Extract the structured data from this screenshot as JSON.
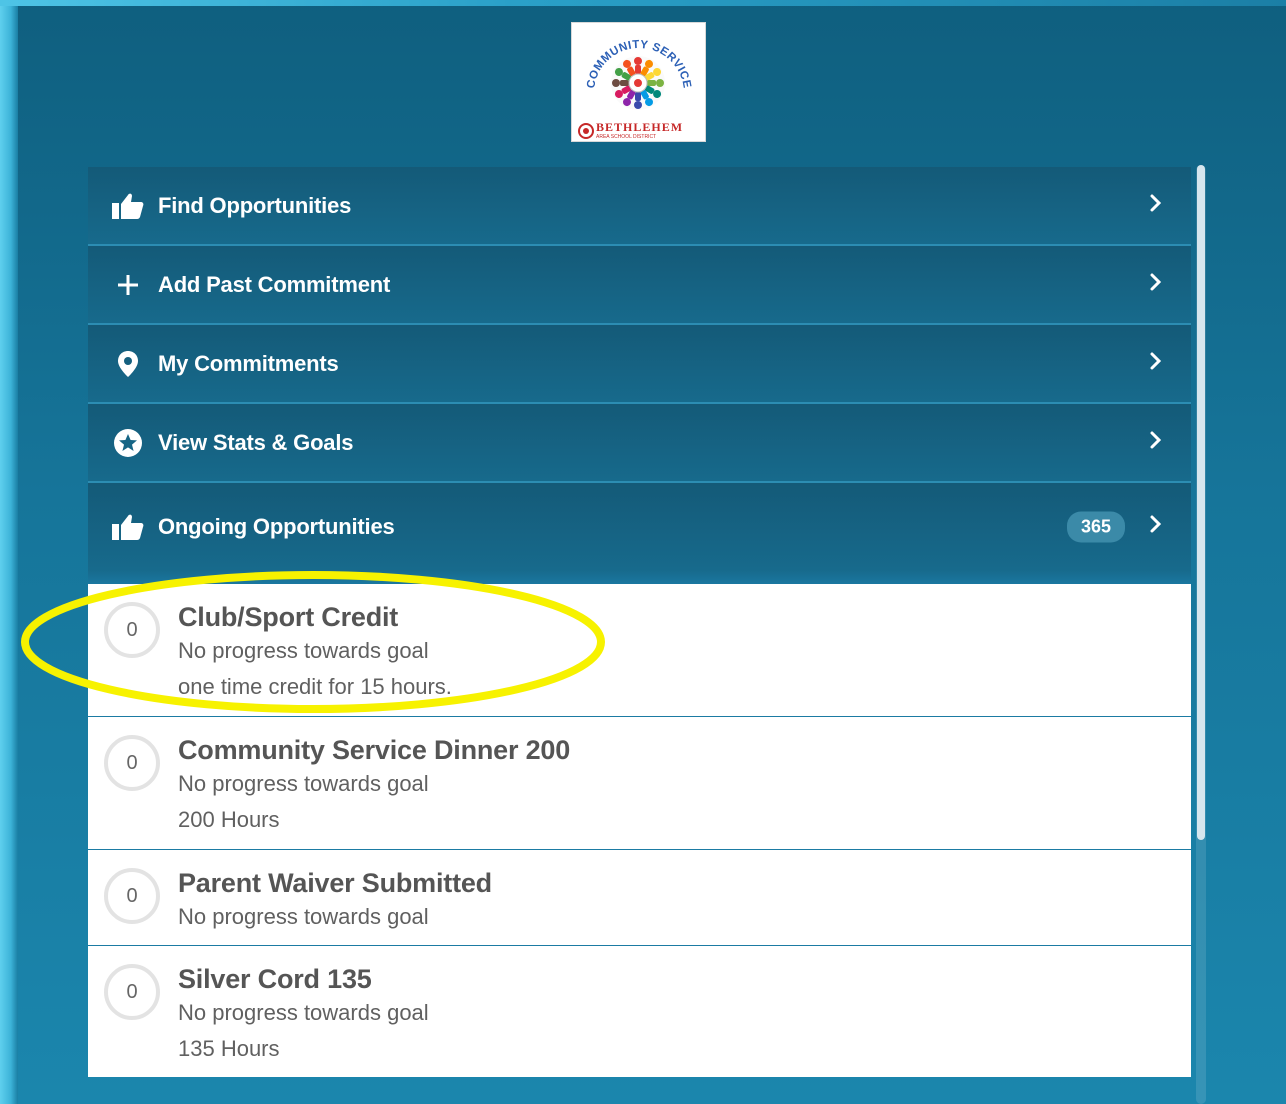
{
  "logo": {
    "arc_text": "COMMUNITY SERVICE",
    "org_text": "BETHLEHEM",
    "district_text": "AREA SCHOOL DISTRICT"
  },
  "menu": [
    {
      "label": "Find Opportunities",
      "icon": "thumbs-up-icon"
    },
    {
      "label": "Add Past Commitment",
      "icon": "plus-icon"
    },
    {
      "label": "My Commitments",
      "icon": "map-pin-icon"
    },
    {
      "label": "View Stats & Goals",
      "icon": "star-circle-icon"
    },
    {
      "label": "Ongoing Opportunities",
      "icon": "thumbs-up-icon",
      "badge": "365"
    }
  ],
  "goals": [
    {
      "progress": "0",
      "title": "Club/Sport Credit",
      "status": "No progress towards goal",
      "detail": "one time credit for 15 hours."
    },
    {
      "progress": "0",
      "title": "Community Service Dinner 200",
      "status": "No progress towards goal",
      "detail": "200 Hours"
    },
    {
      "progress": "0",
      "title": "Parent Waiver Submitted",
      "status": "No progress towards goal",
      "detail": ""
    },
    {
      "progress": "0",
      "title": "Silver Cord 135",
      "status": "No progress towards goal",
      "detail": "135 Hours"
    }
  ],
  "colors": {
    "header_bg": "#145a78",
    "highlight": "#f7f200",
    "ring": "#e3e3e3"
  }
}
